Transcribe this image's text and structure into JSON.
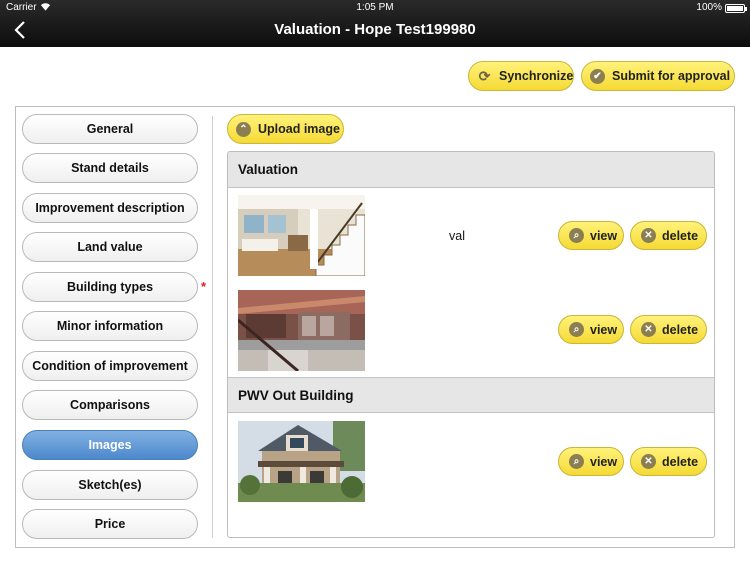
{
  "status": {
    "carrier": "Carrier",
    "time": "1:05 PM",
    "battery": "100%"
  },
  "nav": {
    "title": "Valuation - Hope Test199980"
  },
  "toolbar": {
    "sync_label": "Synchronize",
    "submit_label": "Submit for approval"
  },
  "sidebar": {
    "items": [
      {
        "label": "General"
      },
      {
        "label": "Stand details"
      },
      {
        "label": "Improvement description"
      },
      {
        "label": "Land value"
      },
      {
        "label": "Building types",
        "required": true
      },
      {
        "label": "Minor information"
      },
      {
        "label": "Condition of improvement"
      },
      {
        "label": "Comparisons"
      },
      {
        "label": "Images",
        "active": true
      },
      {
        "label": "Sketch(es)"
      },
      {
        "label": "Price"
      }
    ],
    "required_mark": "*"
  },
  "upload": {
    "label": "Upload image"
  },
  "sections": [
    {
      "title": "Valuation",
      "images": [
        {
          "caption": "val",
          "view_label": "view",
          "delete_label": "delete",
          "thumb": "interior-staircase-photo"
        },
        {
          "caption": "",
          "view_label": "view",
          "delete_label": "delete",
          "thumb": "interior-kitchen-photo"
        }
      ]
    },
    {
      "title": "PWV Out Building",
      "images": [
        {
          "caption": "",
          "view_label": "view",
          "delete_label": "delete",
          "thumb": "house-exterior-photo"
        }
      ]
    }
  ],
  "colors": {
    "accent_yellow": "#f5da34",
    "active_blue": "#4b88cc",
    "required_red": "#e02020"
  }
}
